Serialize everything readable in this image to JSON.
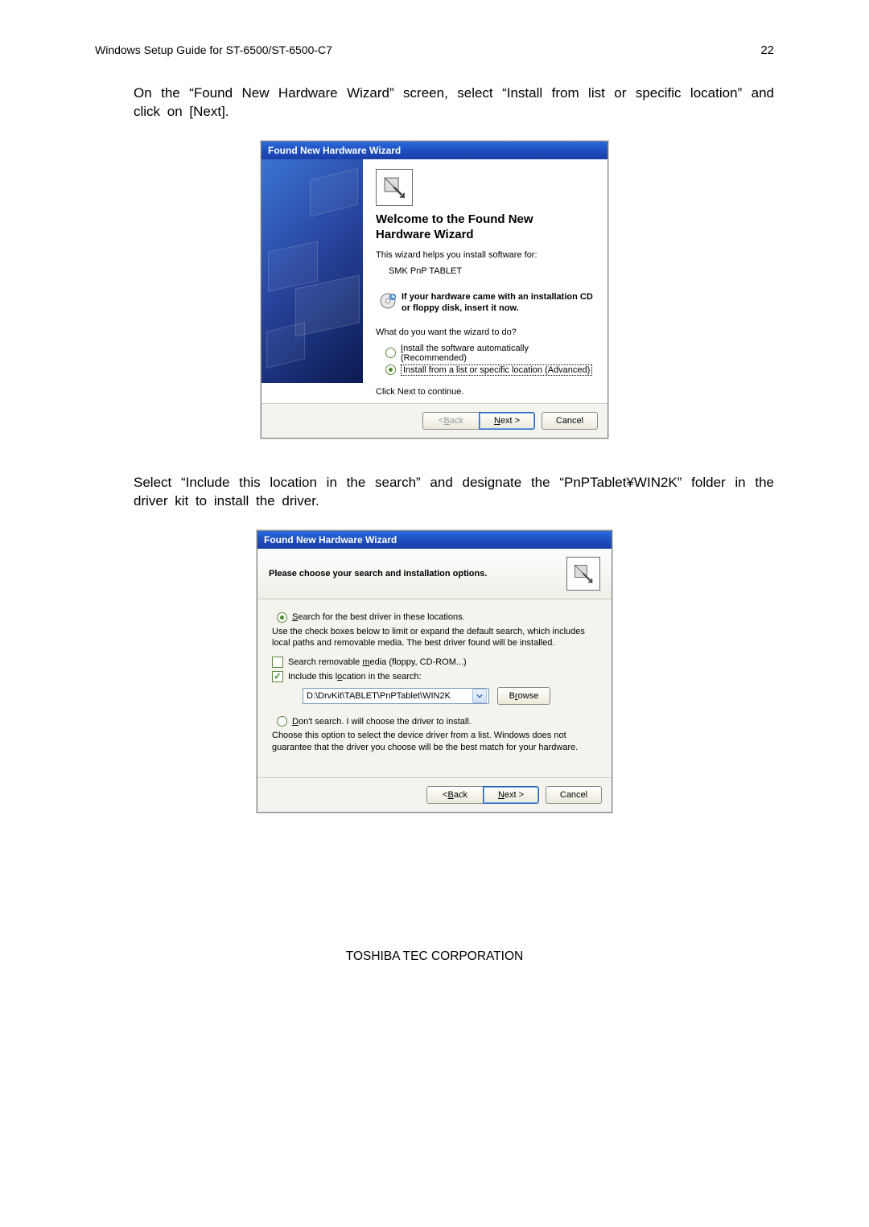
{
  "doc": {
    "header_left": "Windows Setup Guide for ST-6500/ST-6500-C7",
    "page_num": "22",
    "para1": "On the “Found New Hardware Wizard” screen, select “Install from list or specific location” and click on [Next].",
    "para2": "Select “Include this location in the search” and designate the “PnPTablet¥WIN2K” folder in the driver kit to install the driver.",
    "footer": "TOSHIBA TEC CORPORATION"
  },
  "wiz1": {
    "title": "Found New Hardware Wizard",
    "welcome_l1": "Welcome to the Found New",
    "welcome_l2": "Hardware Wizard",
    "helps": "This wizard helps you install software for:",
    "device": "SMK PnP TABLET",
    "cd_l1": "If your hardware came with an installation CD",
    "cd_l2": "or floppy disk, insert it now.",
    "question": "What do you want the wizard to do?",
    "opt_auto": "Install the software automatically (Recommended)",
    "opt_list": "Install from a list or specific location (Advanced)",
    "continue": "Click Next to continue.",
    "btn_back": "< Back",
    "btn_next": "Next >",
    "btn_cancel": "Cancel"
  },
  "wiz2": {
    "title": "Found New Hardware Wizard",
    "header": "Please choose your search and installation options.",
    "opt_search": "Search for the best driver in these locations.",
    "search_desc": "Use the check boxes below to limit or expand the default search, which includes local paths and removable media. The best driver found will be installed.",
    "chk_media": "Search removable media (floppy, CD-ROM...)",
    "chk_include": "Include this location in the search:",
    "path": "D:\\DrvKit\\TABLET\\PnPTablet\\WIN2K",
    "btn_browse": "Browse",
    "opt_dont": "Don't search. I will choose the driver to install.",
    "dont_desc": "Choose this option to select the device driver from a list.  Windows does not guarantee that the driver you choose will be the best match for your hardware.",
    "btn_back": "< Back",
    "btn_next": "Next >",
    "btn_cancel": "Cancel"
  },
  "letters": {
    "B": "B",
    "N": "N",
    "S": "S",
    "m": "m",
    "o": "o",
    "D": "D",
    "R": "R"
  }
}
